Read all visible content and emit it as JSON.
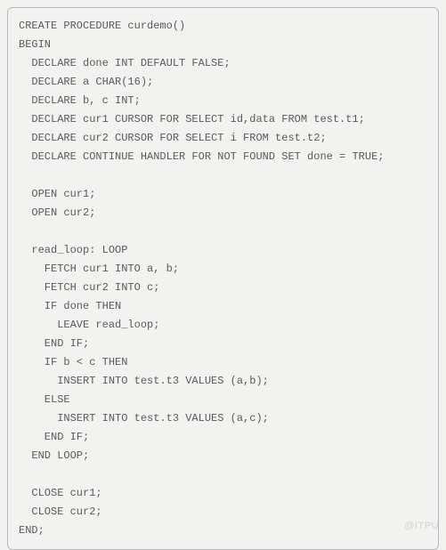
{
  "code": {
    "lines": [
      "CREATE PROCEDURE curdemo()",
      "BEGIN",
      "  DECLARE done INT DEFAULT FALSE;",
      "  DECLARE a CHAR(16);",
      "  DECLARE b, c INT;",
      "  DECLARE cur1 CURSOR FOR SELECT id,data FROM test.t1;",
      "  DECLARE cur2 CURSOR FOR SELECT i FROM test.t2;",
      "  DECLARE CONTINUE HANDLER FOR NOT FOUND SET done = TRUE;",
      "",
      "  OPEN cur1;",
      "  OPEN cur2;",
      "",
      "  read_loop: LOOP",
      "    FETCH cur1 INTO a, b;",
      "    FETCH cur2 INTO c;",
      "    IF done THEN",
      "      LEAVE read_loop;",
      "    END IF;",
      "    IF b < c THEN",
      "      INSERT INTO test.t3 VALUES (a,b);",
      "    ELSE",
      "      INSERT INTO test.t3 VALUES (a,c);",
      "    END IF;",
      "  END LOOP;",
      "",
      "  CLOSE cur1;",
      "  CLOSE cur2;",
      "END;"
    ]
  },
  "watermark": "@ITPU"
}
